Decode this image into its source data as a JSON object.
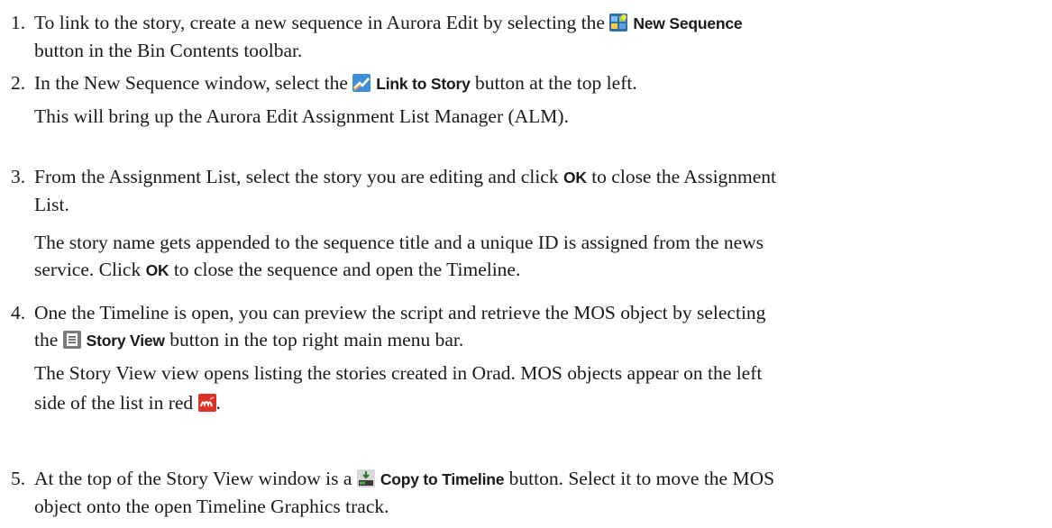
{
  "steps": [
    {
      "number": "1.",
      "paragraphs": [
        {
          "pre": "To link to the story, create a new sequence in Aurora Edit by selecting the ",
          "ui": "New Sequence",
          "post": ""
        },
        {
          "line2": "button in the Bin Contents toolbar."
        }
      ]
    },
    {
      "number": "2.",
      "pre": "In the New Sequence window, select the ",
      "ui": "Link to Story",
      "post": " button at the top left.",
      "note": "This will bring up the Aurora Edit Assignment List Manager (ALM)."
    },
    {
      "number": "3.",
      "pre": "From the Assignment List, select the story you are editing and click ",
      "ui": "OK",
      "post": " to close the Assignment",
      "line2": "List.",
      "note_pre": "The story name gets appended to the sequence title and a unique ID is assigned from the news",
      "note_line2_pre": "service. Click ",
      "note_ui": "OK",
      "note_line2_post": " to close the sequence and open the Timeline."
    },
    {
      "number": "4.",
      "line1": "One the Timeline is open, you can preview the script and retrieve the MOS object by selecting",
      "line2_pre": "the ",
      "ui": "Story View",
      "line2_post": " button in the top right main menu bar.",
      "note_line1": "The Story View view opens listing the stories created in Orad. MOS objects appear on the left",
      "note_line2": "side of the list in red "
    },
    {
      "number": "5.",
      "pre": "At the top of the Story View window is a ",
      "ui": "Copy to Timeline",
      "post": " button. Select it to move the MOS",
      "line2": "object onto the open Timeline Graphics track."
    }
  ],
  "icons": {
    "new_sequence": "new-sequence-icon",
    "link_to_story": "link-to-story-icon",
    "story_view": "story-view-icon",
    "mos": "mos-object-icon",
    "copy_to_timeline": "copy-to-timeline-icon"
  },
  "colors": {
    "text": "#1a1a1a",
    "mos_red": "#e0302a",
    "icon_blue": "#2f7ec8",
    "icon_gray": "#8a8a8a"
  }
}
